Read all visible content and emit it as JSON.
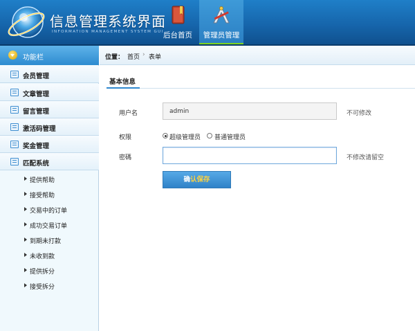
{
  "header": {
    "title": "信息管理系统界面",
    "subtitle": "INFORMATION MANAGEMENT SYSTEM GUI",
    "nav": [
      {
        "label": "后台首页",
        "icon": "book-icon"
      },
      {
        "label": "管理员管理",
        "icon": "admin-tools-icon",
        "active": true
      }
    ]
  },
  "sidebar": {
    "title": "功能栏",
    "items": [
      {
        "label": "会员管理"
      },
      {
        "label": "文章管理"
      },
      {
        "label": "留言管理"
      },
      {
        "label": "激活码管理"
      },
      {
        "label": "奖金管理"
      },
      {
        "label": "匹配系统"
      }
    ],
    "subitems": [
      {
        "label": "提供帮助"
      },
      {
        "label": "接受帮助"
      },
      {
        "label": "交易中的订单"
      },
      {
        "label": "成功交易订单"
      },
      {
        "label": "到期未打款"
      },
      {
        "label": "未收到款"
      },
      {
        "label": "提供拆分"
      },
      {
        "label": "接受拆分"
      }
    ]
  },
  "breadcrumb": {
    "label": "位置：",
    "home": "首页",
    "separator": "›",
    "current": "表单"
  },
  "form": {
    "tab": "基本信息",
    "username_label": "用户名",
    "username_value": "admin",
    "username_hint": "不可修改",
    "role_label": "权限",
    "role_options": [
      {
        "label": "超级管理员",
        "checked": true
      },
      {
        "label": "普通管理员",
        "checked": false
      }
    ],
    "password_label": "密碼",
    "password_value": "",
    "password_hint": "不修改请留空",
    "submit_part1": "确",
    "submit_part2": "认保存"
  },
  "colors": {
    "header_blue": "#1665ab",
    "active_underline": "#7ed321",
    "button_blue": "#2f82c8"
  }
}
